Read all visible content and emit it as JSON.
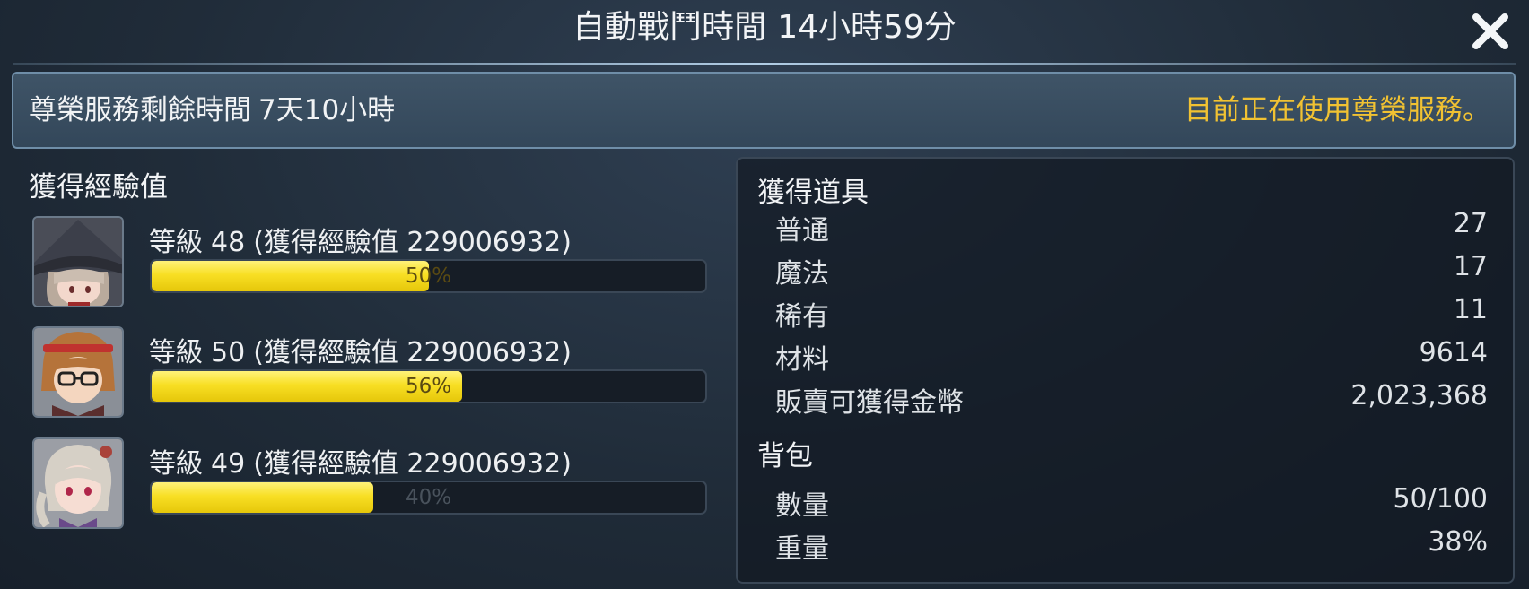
{
  "header": {
    "title_prefix": "自動戰鬥時間",
    "title_value": "14小時59分"
  },
  "vip": {
    "remaining_label": "尊榮服務剩餘時間",
    "remaining_value": "7天10小時",
    "status": "目前正在使用尊榮服務。"
  },
  "exp": {
    "title": "獲得經驗值",
    "characters": [
      {
        "level_label": "等級",
        "level": "48",
        "exp_text": "(獲得經驗值 229006932)",
        "progress": 50,
        "progress_label": "50%"
      },
      {
        "level_label": "等級",
        "level": "50",
        "exp_text": "(獲得經驗值 229006932)",
        "progress": 56,
        "progress_label": "56%"
      },
      {
        "level_label": "等級",
        "level": "49",
        "exp_text": "(獲得經驗值 229006932)",
        "progress": 40,
        "progress_label": "40%"
      }
    ]
  },
  "items": {
    "title": "獲得道具",
    "rows": [
      {
        "label": "普通",
        "value": "27"
      },
      {
        "label": "魔法",
        "value": "17"
      },
      {
        "label": "稀有",
        "value": "11"
      },
      {
        "label": "材料",
        "value": "9614"
      },
      {
        "label": "販賣可獲得金幣",
        "value": "2,023,368"
      }
    ]
  },
  "bag": {
    "title": "背包",
    "rows": [
      {
        "label": "數量",
        "value": "50/100"
      },
      {
        "label": "重量",
        "value": "38%"
      }
    ]
  },
  "colors": {
    "accent_yellow": "#f1c232",
    "exp_fill": "#f8df24",
    "panel_bg": "#1c2631"
  },
  "icons": {
    "close": "close-icon",
    "avatars": [
      "witch-hat-girl-avatar-icon",
      "headband-glasses-boy-avatar-icon",
      "silver-hair-girl-avatar-icon"
    ]
  }
}
